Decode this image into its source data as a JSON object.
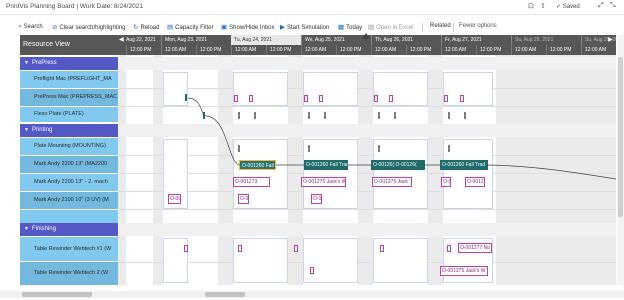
{
  "window": {
    "title": "PrintVis Planning Board | Work Date: 8/24/2021",
    "saved_label": "Saved"
  },
  "toolbar": {
    "search": "Search",
    "clear": "Clear search/highlighting",
    "reload": "Reload",
    "capacity": "Capacity Filter",
    "inbox": "Show/Hide Inbox",
    "simulation": "Start Simulation",
    "today": "Today",
    "excel": "Open in Excel",
    "related": "Related",
    "fewer": "Fewer options"
  },
  "resource_view": {
    "header": "Resource View",
    "groups": [
      {
        "label": "PrePress"
      },
      {
        "label": "Printing"
      },
      {
        "label": "Finishing"
      }
    ],
    "resources": [
      "Preflight Mac (PREFLIGHT_MA",
      "PrePress Mac (PREPRESS_MAC",
      "Flexo Plate (PLATE)",
      "Plate Mounting (MOUNTING)",
      "Mark Andy 2200 13\" (MA2200",
      "Mark Andy 2200 13\" - 2. mach",
      "Mark Andy 2100 10\" (3 UV) (M",
      "Table Rewinder Webtech #1 (W",
      "Table Rewinder Webtech 2 (W"
    ]
  },
  "timeline": {
    "days": [
      "Aug 22, 2021",
      "Mon, Aug 23, 2021",
      "Tu, Aug 24, 2021",
      "We, Aug 25, 2021",
      "Th, Aug 26, 2021",
      "Fr, Aug 27, 2021",
      "Sa, Aug 28, 2021",
      "Su, Aug 29, 2021"
    ],
    "times": [
      "12:00 PM",
      "12:00 AM",
      "12:00 PM",
      "12:00 AM",
      "12:00 PM",
      "12:00 AM",
      "12:00 PM",
      "12:00 AM",
      "12:00 PM",
      "12:00 AM",
      "12:00 PM",
      "12:00 AM",
      "12:00 PM",
      "12:00 AM",
      "12:00 PM"
    ]
  },
  "jobs": {
    "mark_andy_1": [
      "O-001260 Fall",
      "O-001260 Fall Trade",
      "O-00126( O-00126(",
      "O-001260 Fall Trad"
    ],
    "mark_andy_2": [
      "O-001273",
      "O-001275 Jack's W",
      "O-001275 Jack",
      "O-00",
      "O-0012"
    ],
    "mark_andy_3": [
      "O-00",
      "O-0",
      "O-0"
    ],
    "rewinder_1": [
      "O-001277 No"
    ],
    "rewinder_2": [
      "O-001275 Jack's W"
    ]
  },
  "colors": {
    "group": "#5459c5",
    "resource": "#81c9ef",
    "header": "#575757",
    "scheduled": "#1f6b6b",
    "unscheduled_border": "#c43fa0",
    "selected": "#f7b733"
  }
}
